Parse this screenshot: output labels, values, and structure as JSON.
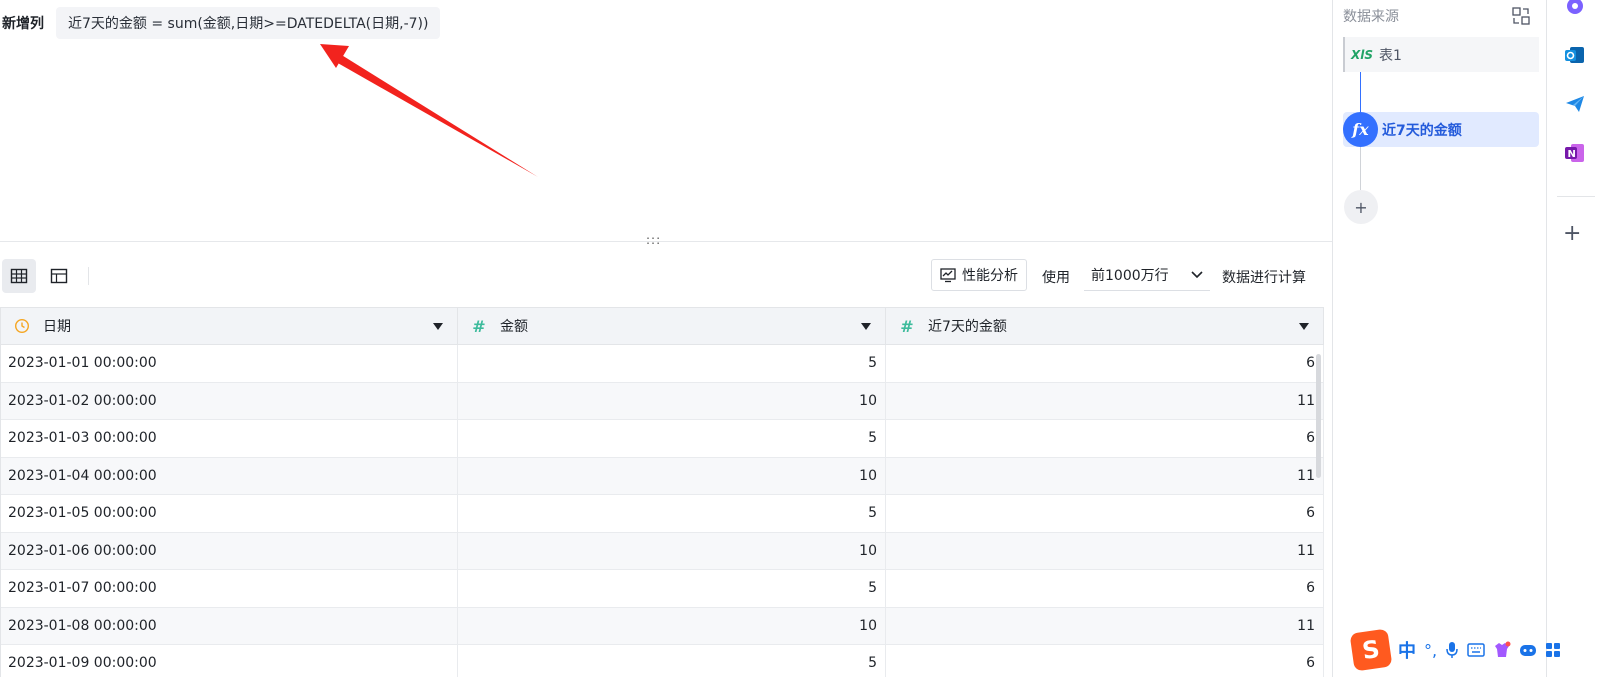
{
  "formula": {
    "label": "新增列",
    "expression": "近7天的金额 = sum(金额,日期>=DATEDELTA(日期,-7))"
  },
  "splitter": {
    "handle": ":::"
  },
  "toolbar": {
    "perf_label": "性能分析",
    "use_label": "使用",
    "rows_option": "前1000万行",
    "calc_label": "数据进行计算"
  },
  "table": {
    "columns": [
      {
        "label": "日期",
        "type": "date",
        "icon": "clock-icon"
      },
      {
        "label": "金额",
        "type": "number",
        "icon": "hash-icon"
      },
      {
        "label": "近7天的金额",
        "type": "number",
        "icon": "hash-icon"
      }
    ],
    "rows": [
      [
        "2023-01-01 00:00:00",
        "5",
        "6"
      ],
      [
        "2023-01-02 00:00:00",
        "10",
        "11"
      ],
      [
        "2023-01-03 00:00:00",
        "5",
        "6"
      ],
      [
        "2023-01-04 00:00:00",
        "10",
        "11"
      ],
      [
        "2023-01-05 00:00:00",
        "5",
        "6"
      ],
      [
        "2023-01-06 00:00:00",
        "10",
        "11"
      ],
      [
        "2023-01-07 00:00:00",
        "5",
        "6"
      ],
      [
        "2023-01-08 00:00:00",
        "10",
        "11"
      ],
      [
        "2023-01-09 00:00:00",
        "5",
        "6"
      ]
    ]
  },
  "right_panel": {
    "title": "数据来源",
    "source_badge": "XlS",
    "source_name": "表1",
    "calc_step": "近7天的金额",
    "fx": "fx",
    "add": "+"
  },
  "edge_bar": {
    "icons": [
      "copilot-icon",
      "outlook-icon",
      "send-icon",
      "onenote-icon"
    ],
    "plus": "+"
  },
  "ime": {
    "logo": "S",
    "mode": "中",
    "punct": "°,"
  },
  "colors": {
    "accent": "#3370ff",
    "arrow": "#f2231e",
    "header_bg": "#f2f4f7",
    "date_icon": "#f5a623",
    "num_icon": "#3dbb9c"
  }
}
